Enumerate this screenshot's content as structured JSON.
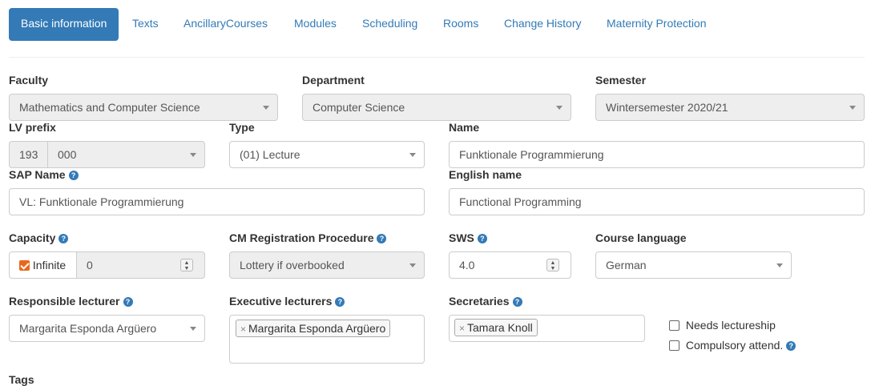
{
  "tabs": [
    {
      "label": "Basic information",
      "active": true
    },
    {
      "label": "Texts"
    },
    {
      "label": "AncillaryCourses"
    },
    {
      "label": "Modules"
    },
    {
      "label": "Scheduling"
    },
    {
      "label": "Rooms"
    },
    {
      "label": "Change History"
    },
    {
      "label": "Maternity Protection"
    }
  ],
  "form": {
    "faculty": {
      "label": "Faculty",
      "value": "Mathematics and Computer Science"
    },
    "department": {
      "label": "Department",
      "value": "Computer Science"
    },
    "semester": {
      "label": "Semester",
      "value": "Wintersemester 2020/21"
    },
    "lv_prefix": {
      "label": "LV prefix",
      "prefix": "193",
      "value": "000"
    },
    "type": {
      "label": "Type",
      "value": "(01) Lecture"
    },
    "name": {
      "label": "Name",
      "value": "Funktionale Programmierung"
    },
    "sap_name": {
      "label": "SAP Name",
      "value": "VL: Funktionale Programmierung"
    },
    "english_name": {
      "label": "English name",
      "value": "Functional Programming"
    },
    "capacity": {
      "label": "Capacity",
      "infinite_label": "Infinite",
      "infinite_checked": true,
      "value": "0"
    },
    "cm_registration": {
      "label": "CM Registration Procedure",
      "value": "Lottery if overbooked"
    },
    "sws": {
      "label": "SWS",
      "value": "4.0"
    },
    "course_language": {
      "label": "Course language",
      "value": "German"
    },
    "responsible_lecturer": {
      "label": "Responsible lecturer",
      "value": "Margarita Esponda Argüero"
    },
    "executive_lecturers": {
      "label": "Executive lecturers",
      "tags": [
        "Margarita Esponda Argüero"
      ]
    },
    "secretaries": {
      "label": "Secretaries",
      "tags": [
        "Tamara Knoll"
      ]
    },
    "needs_lectureship": {
      "label": "Needs lectureship",
      "checked": false
    },
    "compulsory_attend": {
      "label": "Compulsory attend.",
      "checked": false
    },
    "tags_label": "Tags"
  },
  "icons": {
    "help": "?",
    "tag_remove": "×",
    "spin": "⌃⌄"
  },
  "colors": {
    "accent": "#337ab7",
    "checkbox_on": "#e8681d",
    "disabled_bg": "#eeeeee"
  }
}
